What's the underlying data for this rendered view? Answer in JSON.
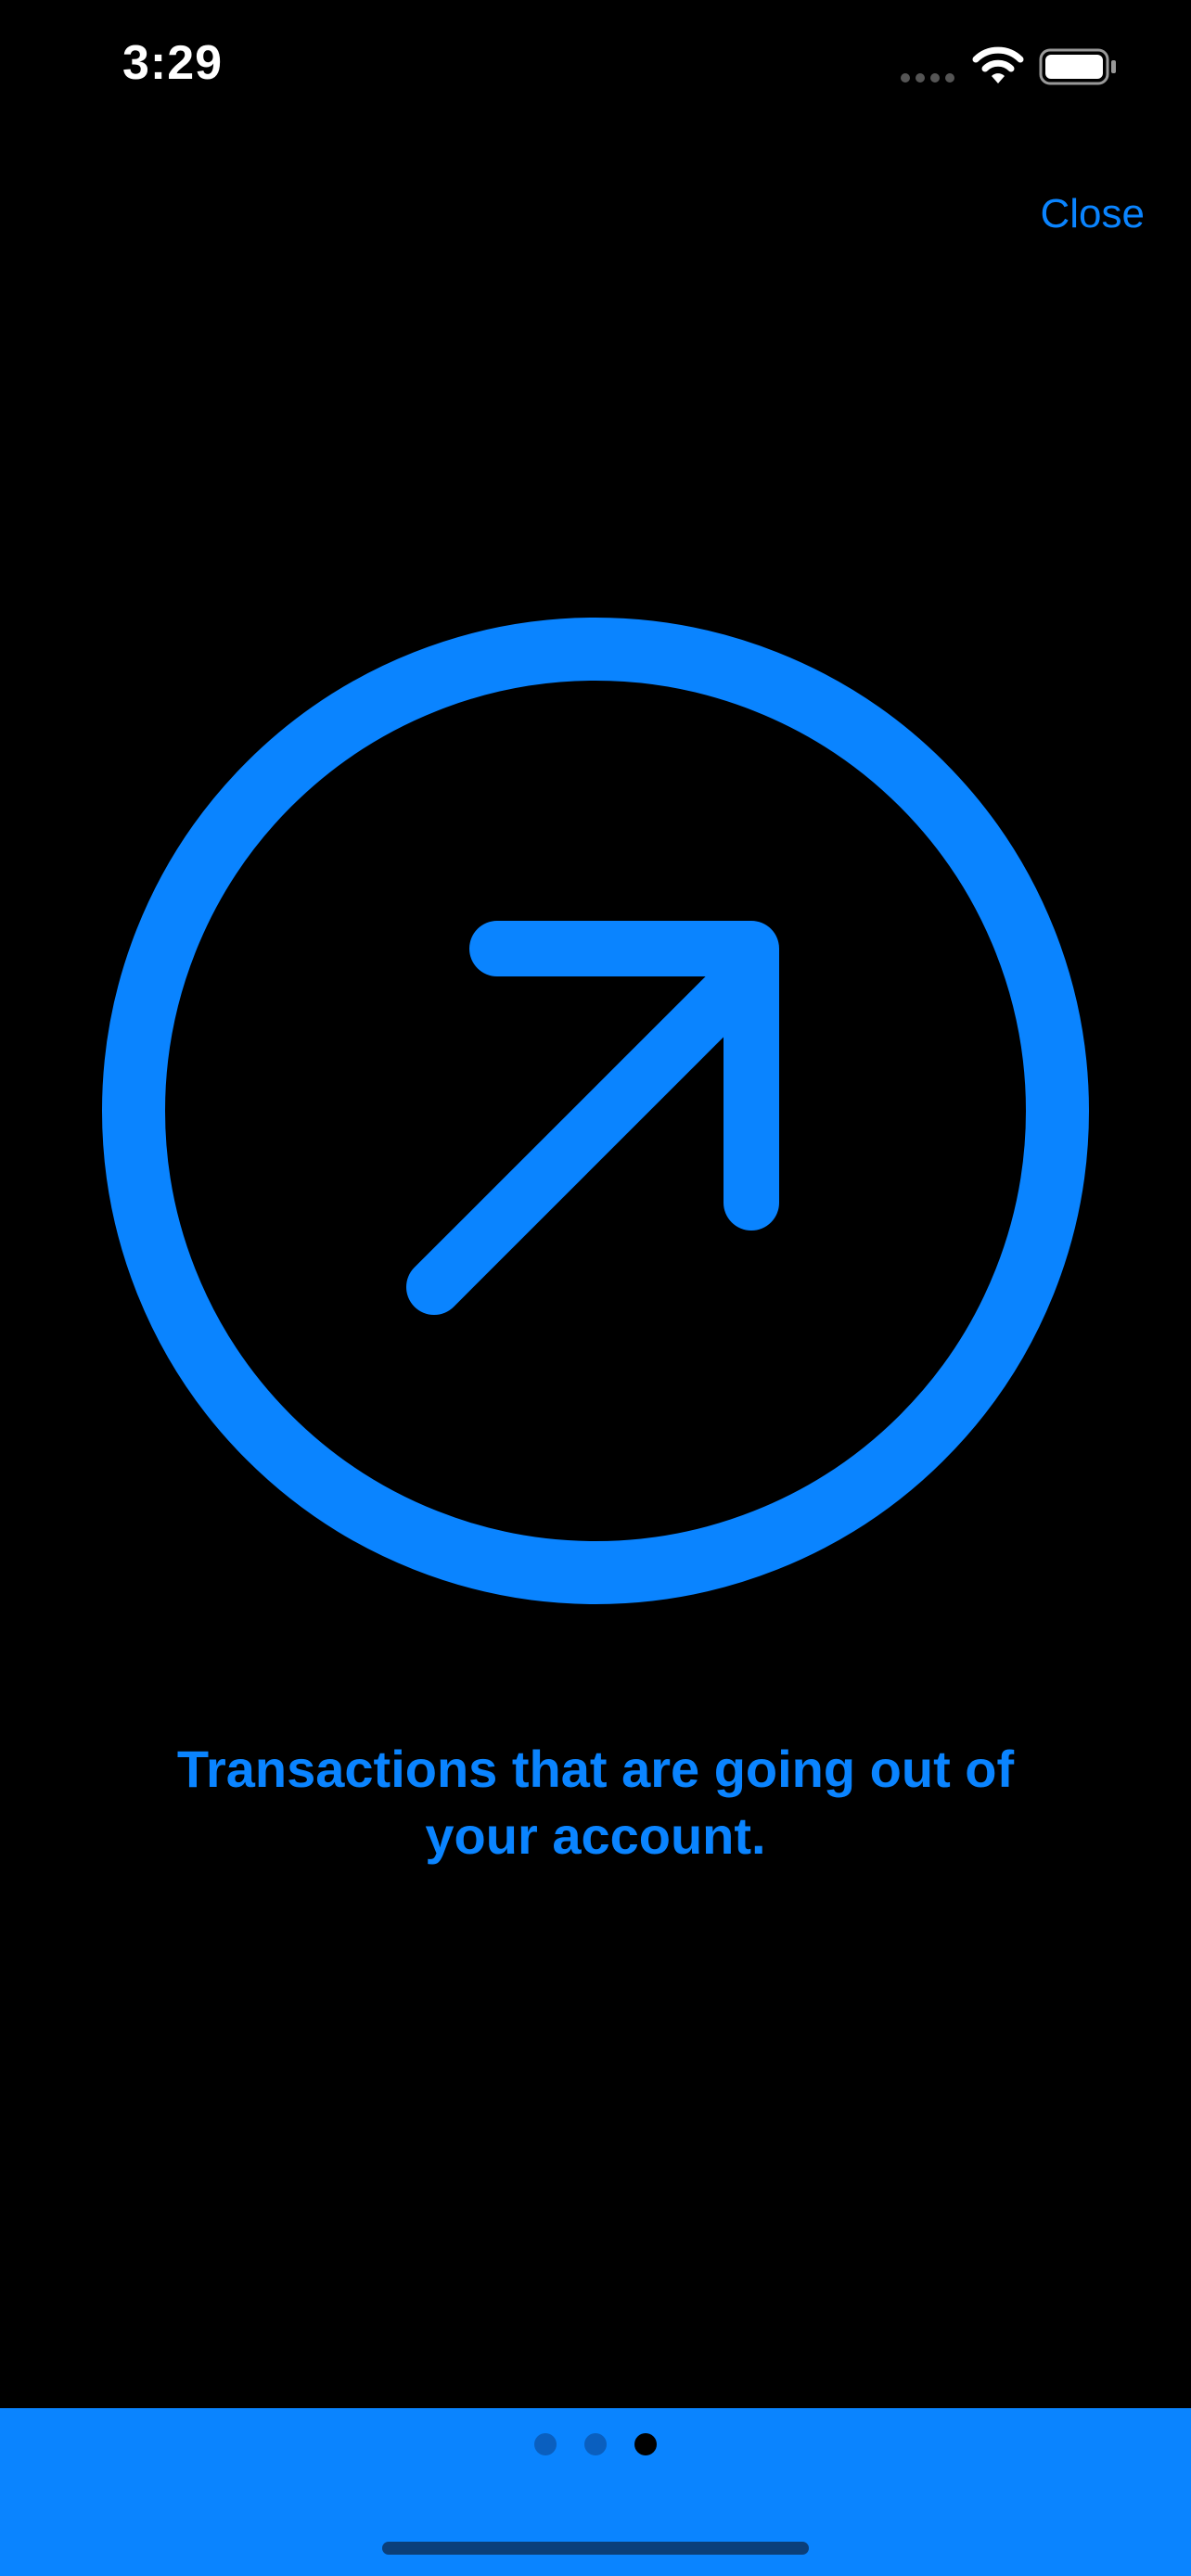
{
  "status_bar": {
    "time": "3:29"
  },
  "header": {
    "close_label": "Close"
  },
  "hero": {
    "icon": "arrow-up-right-circle-icon",
    "color": "#0a84ff"
  },
  "content": {
    "description": "Transactions that are going out of your account."
  },
  "pager": {
    "page_count": 3,
    "current_page": 3
  },
  "colors": {
    "accent": "#0a84ff",
    "background": "#000000",
    "dot_inactive": "#0a5fbf",
    "dot_active": "#000000"
  }
}
